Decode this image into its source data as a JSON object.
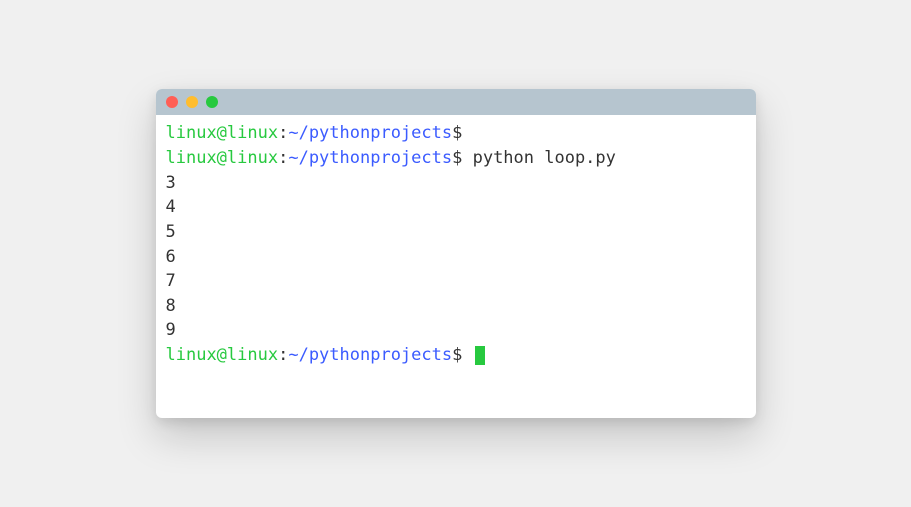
{
  "prompt": {
    "user": "linux@linux",
    "sep1": ":",
    "path": "~/pythonprojects",
    "sep2": "$"
  },
  "lines": [
    {
      "type": "prompt",
      "command": ""
    },
    {
      "type": "prompt",
      "command": "python loop.py"
    },
    {
      "type": "output",
      "text": "3"
    },
    {
      "type": "output",
      "text": "4"
    },
    {
      "type": "output",
      "text": "5"
    },
    {
      "type": "output",
      "text": "6"
    },
    {
      "type": "output",
      "text": "7"
    },
    {
      "type": "output",
      "text": "8"
    },
    {
      "type": "output",
      "text": "9"
    },
    {
      "type": "prompt",
      "command": "",
      "cursor": true
    }
  ]
}
